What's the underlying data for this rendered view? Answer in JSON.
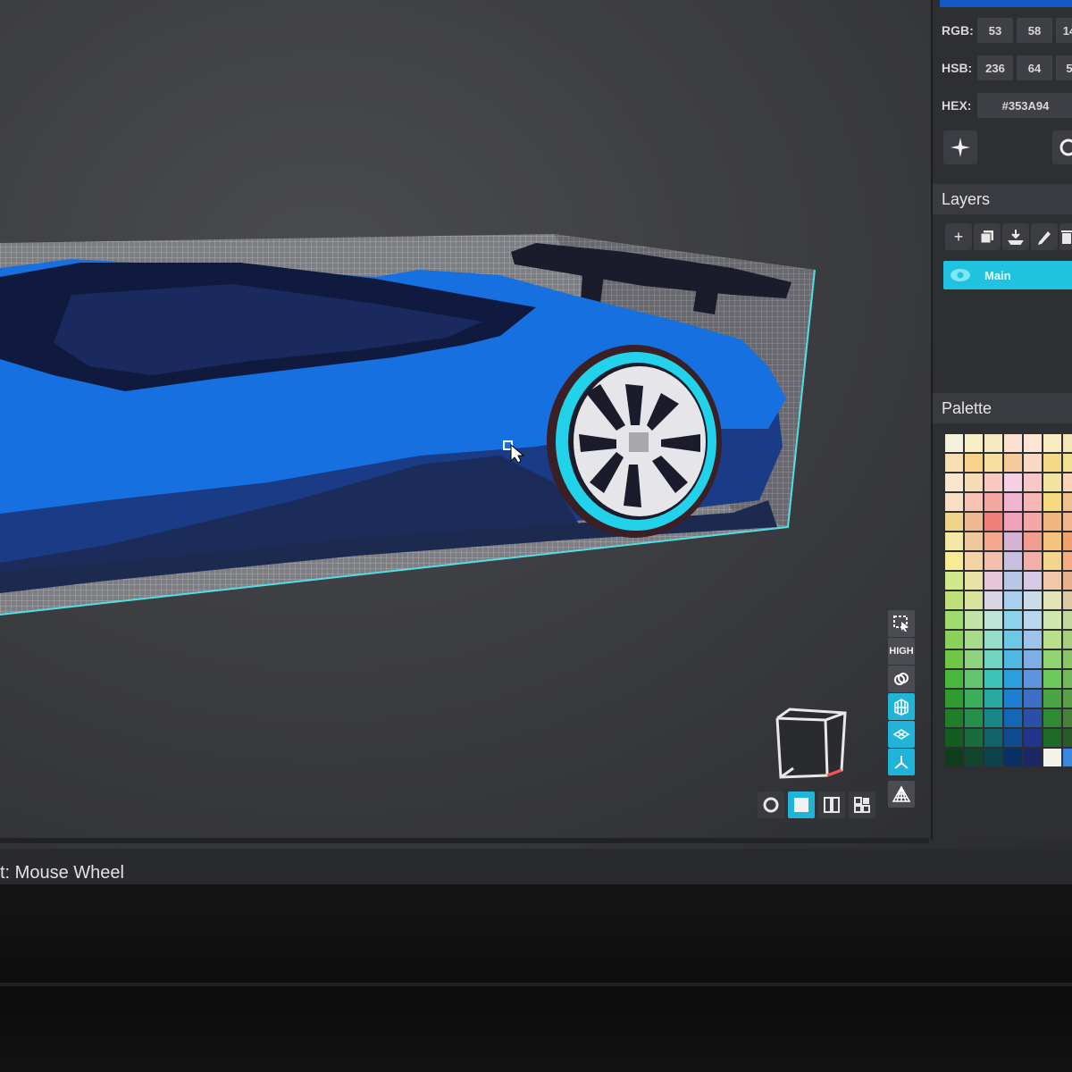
{
  "color": {
    "rgb": {
      "label": "RGB:",
      "r": "53",
      "g": "58",
      "b": "14"
    },
    "hsb": {
      "label": "HSB:",
      "h": "236",
      "s": "64",
      "b": "5"
    },
    "hex": {
      "label": "HEX:",
      "value": "#353A94"
    },
    "swatch": "#1559c8"
  },
  "layers": {
    "title": "Layers",
    "tools": [
      "add-icon",
      "duplicate-icon",
      "merge-icon",
      "pencil-icon",
      "delete-icon"
    ],
    "items": [
      {
        "name": "Main",
        "visible": true
      }
    ]
  },
  "palette": {
    "title": "Palette",
    "colors": [
      "#f3f0dc",
      "#f6efc8",
      "#f6e9c0",
      "#fbe1cf",
      "#fde4d6",
      "#f7ecc2",
      "#f3e7b6",
      "#f7dfb3",
      "#f8d18a",
      "#f6e0a1",
      "#f6cb9c",
      "#f8d9c6",
      "#f3d887",
      "#efe191",
      "#f8e7cc",
      "#f6dcb6",
      "#f9c7bd",
      "#f5cfe2",
      "#f7c6c8",
      "#f4e2a0",
      "#f9d4b8",
      "#f6dfc5",
      "#f9c3b3",
      "#f4a8a1",
      "#f3b4d2",
      "#f7b7b7",
      "#f6da7e",
      "#f2c08a",
      "#f0d48e",
      "#f1b98f",
      "#f07f7a",
      "#f1a0b7",
      "#f4a7a4",
      "#f0b67e",
      "#f4b58e",
      "#f2e9a4",
      "#eec79a",
      "#f4a88e",
      "#d6b3d3",
      "#f19c8e",
      "#f6c27c",
      "#f2a06e",
      "#f6ec98",
      "#f3d3a5",
      "#f4c0ae",
      "#c9bfe0",
      "#f3aea8",
      "#f2d48a",
      "#f4ad83",
      "#cfe888",
      "#e6e3a5",
      "#e6c6d8",
      "#b6c8e6",
      "#d7c9e6",
      "#f2c7a8",
      "#e9b18c",
      "#bde078",
      "#d6e49c",
      "#d8d4e4",
      "#a8d0ec",
      "#c9dce8",
      "#e4e3b8",
      "#dbcaa6",
      "#9fdc6e",
      "#c2e4a6",
      "#bde4d6",
      "#8ed3ec",
      "#b8d7ef",
      "#cfe7ad",
      "#c4d79e",
      "#89d25a",
      "#a9d98a",
      "#96dec8",
      "#6fc8e8",
      "#9fc4ec",
      "#b8e08a",
      "#a8cf80",
      "#6cc744",
      "#8fd17c",
      "#6fd4c0",
      "#4fb8e4",
      "#7faee6",
      "#93d472",
      "#8cc468",
      "#49b83a",
      "#63c56e",
      "#3fc3b6",
      "#2a9fdc",
      "#5f93de",
      "#6ec95c",
      "#74b85a",
      "#2f9c2e",
      "#3cae5a",
      "#27a8a0",
      "#1d7fcf",
      "#3d6ec8",
      "#4aa544",
      "#5b9e4a",
      "#1f7f28",
      "#258f4a",
      "#19878a",
      "#1566b4",
      "#2a4fa6",
      "#2f8a34",
      "#47803a",
      "#145c22",
      "#196d3c",
      "#106468",
      "#0f4b8e",
      "#22358a",
      "#1f6a28",
      "#2c5a2a",
      "#0f3e1a",
      "#11462c",
      "#0b434a",
      "#0a3166",
      "#1c2766",
      "#f2f2ea",
      "#3a86e0"
    ]
  },
  "viewport": {
    "tools": [
      "select-icon",
      "HIGH",
      "link-icon",
      "grid-box-icon",
      "grid-plane-icon",
      "axes-icon",
      "perspective-icon"
    ],
    "view_modes": [
      "circle-icon",
      "single-view-icon",
      "split-view-icon",
      "quad-view-icon"
    ]
  },
  "status": {
    "text": "t: Mouse Wheel"
  },
  "accent": "#1fc3df"
}
